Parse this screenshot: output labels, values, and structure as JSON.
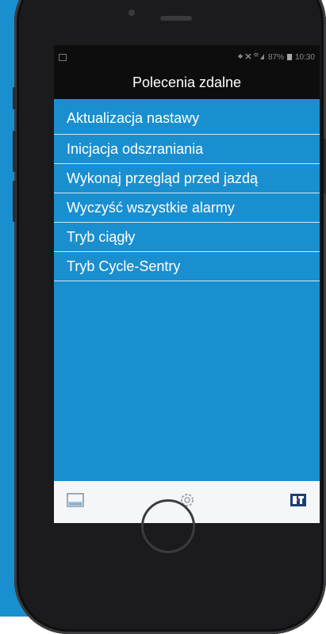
{
  "colors": {
    "accent": "#1a8fd0",
    "screen_bg": "#0d0d0d",
    "bottombar_bg": "#f5f6f7",
    "divider": "#cfe6f6"
  },
  "status_bar": {
    "left_icon": "image-icon",
    "indicators_icon": "signal-wifi-icons",
    "battery_text": "87%",
    "time": "10:30"
  },
  "header": {
    "title": "Polecenia zdalne"
  },
  "menu": {
    "items": [
      {
        "label": "Aktualizacja nastawy"
      },
      {
        "label": "Inicjacja odszraniania"
      },
      {
        "label": "Wykonaj przegląd przed jazdą"
      },
      {
        "label": "Wyczyść wszystkie alarmy"
      },
      {
        "label": "Tryb ciągły"
      },
      {
        "label": "Tryb Cycle-Sentry"
      }
    ]
  },
  "bottom_bar": {
    "left_icon": "keyboard-icon",
    "center_icon": "gear-icon",
    "right_icon": "brand-logo-icon"
  }
}
